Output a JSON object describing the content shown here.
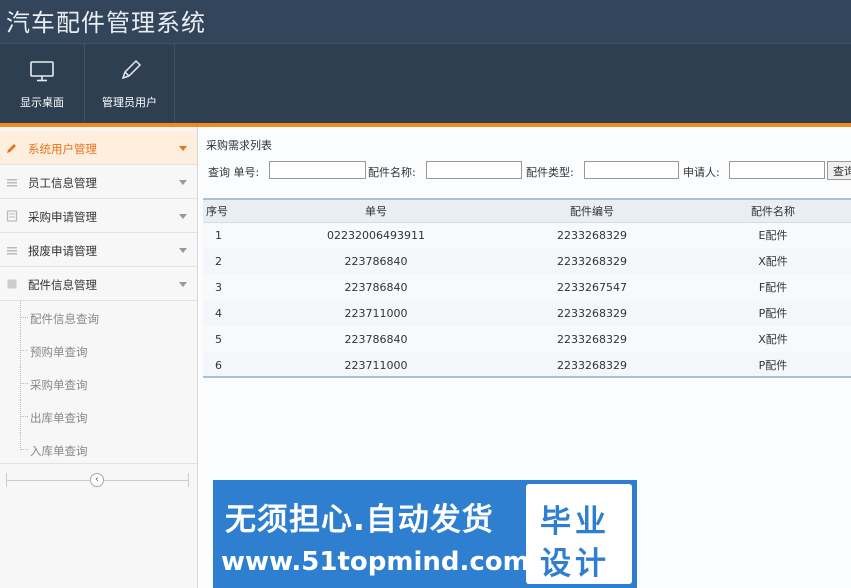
{
  "header": {
    "title": "汽车配件管理系统",
    "toolbar": [
      {
        "label": "显示桌面",
        "icon": "monitor-icon"
      },
      {
        "label": "管理员用户",
        "icon": "pencil-icon"
      }
    ]
  },
  "sidebar": {
    "items": [
      {
        "label": "系统用户管理",
        "icon": "pencil-icon",
        "active": true
      },
      {
        "label": "员工信息管理",
        "icon": "list-icon"
      },
      {
        "label": "采购申请管理",
        "icon": "document-icon"
      },
      {
        "label": "报废申请管理",
        "icon": "list-icon"
      },
      {
        "label": "配件信息管理",
        "icon": "box-icon"
      }
    ],
    "sub_items": [
      "配件信息查询",
      "预购单查询",
      "采购单查询",
      "出库单查询",
      "入库单查询"
    ]
  },
  "main": {
    "panel_title": "采购需求列表",
    "search": {
      "query_label": "查询 单号:",
      "part_name_label": "配件名称:",
      "part_type_label": "配件类型:",
      "applicant_label": "申请人:",
      "button_label": "查询"
    },
    "table": {
      "columns": [
        "序号",
        "单号",
        "配件编号",
        "配件名称"
      ],
      "rows": [
        [
          "1",
          "02232006493911",
          "2233268329",
          "E配件"
        ],
        [
          "2",
          "223786840",
          "2233268329",
          "X配件"
        ],
        [
          "3",
          "223786840",
          "2233267547",
          "F配件"
        ],
        [
          "4",
          "223711000",
          "2233268329",
          "P配件"
        ],
        [
          "5",
          "223786840",
          "2233268329",
          "X配件"
        ],
        [
          "6",
          "223711000",
          "2233268329",
          "P配件"
        ]
      ]
    }
  },
  "watermark": {
    "line1": "无须担心.自动发货",
    "line2": "www.51topmind.com",
    "box_line1": "毕业",
    "box_line2": "设计"
  },
  "colors": {
    "header_bg": "#33455a",
    "accent_orange": "#f08c1b",
    "watermark_blue": "#2f7fd1"
  }
}
